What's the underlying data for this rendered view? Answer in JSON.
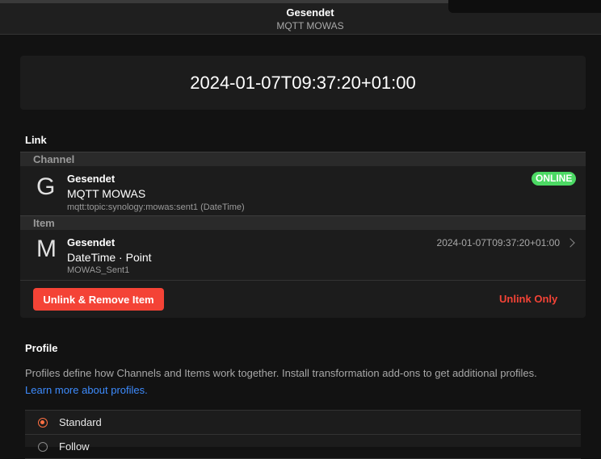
{
  "navbar": {
    "title": "Gesendet",
    "subtitle": "MQTT MOWAS"
  },
  "state_card": {
    "value": "2024-01-07T09:37:20+01:00"
  },
  "link_section": {
    "title": "Link",
    "channel_header": "Channel",
    "channel": {
      "letter": "G",
      "label": "Gesendet",
      "thing": "MQTT MOWAS",
      "uid": "mqtt:topic:synology:mowas:sent1 (DateTime)",
      "status": "ONLINE",
      "status_color": "#4cd964"
    },
    "item_header": "Item",
    "item": {
      "letter": "M",
      "label": "Gesendet",
      "type": "DateTime · Point",
      "name": "MOWAS_Sent1",
      "state": "2024-01-07T09:37:20+01:00"
    },
    "unlink_remove_label": "Unlink & Remove Item",
    "unlink_only_label": "Unlink Only",
    "danger_color": "#f44336"
  },
  "profile_section": {
    "title": "Profile",
    "description": "Profiles define how Channels and Items work together. Install transformation add-ons to get additional profiles.",
    "learn_more": "Learn more about profiles.",
    "options": [
      {
        "label": "Standard",
        "checked": true
      },
      {
        "label": "Follow",
        "checked": false
      }
    ]
  }
}
